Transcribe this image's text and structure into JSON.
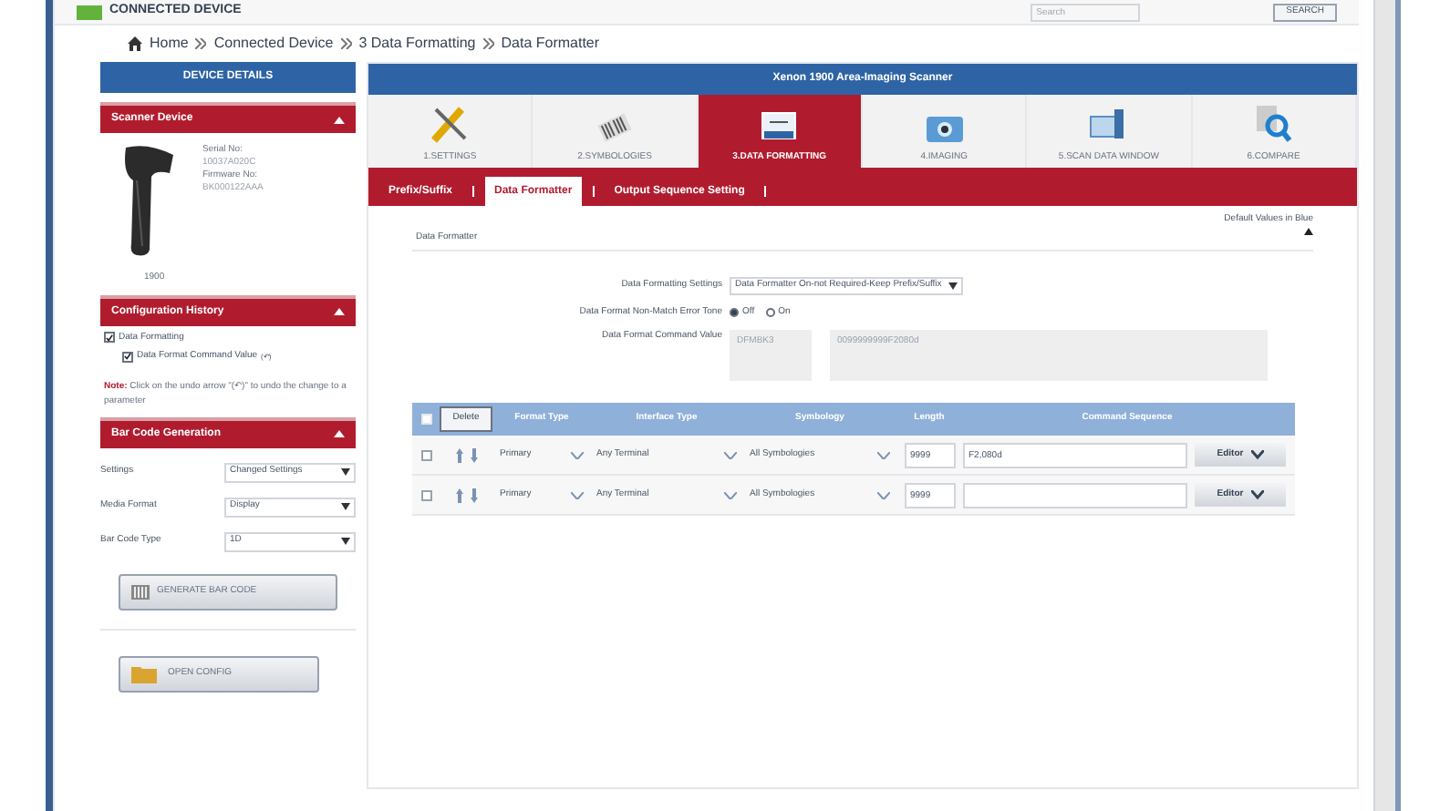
{
  "header": {
    "title": "CONNECTED DEVICE",
    "search": {
      "placeholder": "Search"
    },
    "button": "SEARCH"
  },
  "breadcrumb": [
    "Home",
    "Connected Device",
    "3 Data Formatting",
    "Data Formatter"
  ],
  "sidebar": {
    "title": "DEVICE DETAILS",
    "scanner": {
      "title": "Scanner Device",
      "expanded": true,
      "serial_label": "Serial No:",
      "serial": "10037A020C",
      "firmware_label": "Firmware No:",
      "firmware": "BK000122AAA",
      "model": "1900"
    },
    "history": {
      "title": "Configuration History",
      "expanded": true,
      "items": [
        {
          "label": "Data Formatting",
          "checked": true,
          "children": [
            {
              "label": "Data Format Command Value",
              "checked": true,
              "undo": "(↶)"
            }
          ]
        }
      ],
      "note_label": "Note:",
      "note": "Click on the undo arrow \"(↶)\" to undo the change to a parameter"
    },
    "barcode": {
      "title": "Bar Code Generation",
      "expanded": true,
      "fields": [
        {
          "label": "Settings",
          "value": "Changed Settings"
        },
        {
          "label": "Media Format",
          "value": "Display"
        },
        {
          "label": "Bar Code Type",
          "value": "1D"
        }
      ],
      "button": "GENERATE BAR CODE"
    },
    "open_button": "OPEN CONFIG"
  },
  "main": {
    "title": "Xenon 1900 Area-Imaging Scanner",
    "tabs": [
      {
        "label": "1.SETTINGS",
        "kind": "tools",
        "selected": false
      },
      {
        "label": "2.SYMBOLOGIES",
        "kind": "barcode",
        "selected": false
      },
      {
        "label": "3.DATA FORMATTING",
        "kind": "monitor",
        "selected": true
      },
      {
        "label": "4.IMAGING",
        "kind": "camera",
        "selected": false
      },
      {
        "label": "5.SCAN DATA WINDOW",
        "kind": "window",
        "selected": false
      },
      {
        "label": "6.COMPARE",
        "kind": "compare",
        "selected": false
      }
    ],
    "subtabs": [
      {
        "label": "Prefix/Suffix",
        "selected": false
      },
      {
        "label": "Data Formatter",
        "selected": true
      },
      {
        "label": "Output Sequence Setting",
        "selected": false
      }
    ],
    "section_title": "Data Formatter",
    "defaults_note": "Default Values in Blue",
    "settings_label": "Data Formatting Settings",
    "settings_value": "Data Formatter On-not Required-Keep Prefix/Suffix",
    "error_tone_label": "Data Format Non-Match Error Tone",
    "error_tone": [
      {
        "label": "Off",
        "selected": true
      },
      {
        "label": "On",
        "selected": false
      }
    ],
    "command_label": "Data Format Command Value",
    "command_prefix": "DFMBK3",
    "command_value": "0099999999F2080d",
    "table": {
      "select_all_checked": false,
      "delete": "Delete",
      "columns": [
        "Format Type",
        "Interface Type",
        "Symbology",
        "Length",
        "Command Sequence"
      ],
      "rows": [
        {
          "checked": false,
          "format_type": "Primary",
          "interface": "Any Terminal",
          "symbology": "All Symbologies",
          "length": "9999",
          "command": "F2,080d",
          "editor": "Editor"
        },
        {
          "checked": false,
          "format_type": "Primary",
          "interface": "Any Terminal",
          "symbology": "All Symbologies",
          "length": "9999",
          "command": "",
          "editor": "Editor"
        }
      ]
    }
  }
}
